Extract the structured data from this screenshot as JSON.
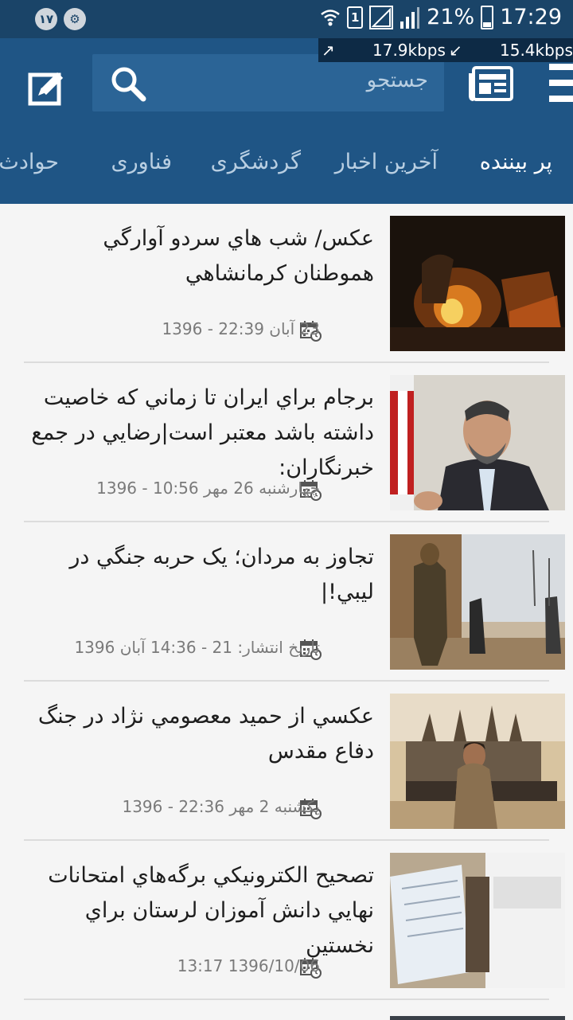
{
  "status_bar": {
    "notification_badge": "١٧",
    "sim_slot": "1",
    "battery_percent": "21%",
    "time": "17:29",
    "upload_speed": "17.9kbps",
    "download_speed": "15.4kbps"
  },
  "search": {
    "placeholder": "جستجو"
  },
  "tabs": [
    {
      "label": "پر بیننده",
      "active": true
    },
    {
      "label": "آخرین اخبار",
      "active": false
    },
    {
      "label": "گردشگری",
      "active": false
    },
    {
      "label": "فناوری",
      "active": false
    },
    {
      "label": "حوادث",
      "active": false
    }
  ],
  "articles": [
    {
      "title": "عكس/ شب هاي سردو آوارگي هموطنان كرمانشاهي",
      "date": "23 آبان 22:39 - 1396"
    },
    {
      "title": "برجام براي ايران تا زماني كه خاصيت داشته باشد معتبر است|رضايي در جمع خبرنگاران:",
      "date": "چهارشنبه 26 مهر 10:56 - 1396"
    },
    {
      "title": "تجاوز به مردان؛ یک حربه جنگي در ليبي!|",
      "date": "تاریخ انتشار: 21 - 14:36 آبان 1396"
    },
    {
      "title": "عكسي از حميد معصومي نژاد در جنگ دفاع مقدس",
      "date": "یکشنبه 2 مهر 22:36 - 1396"
    },
    {
      "title": "تصحيح الكترونيكي برگه‌هاي امتحانات نهايي دانش آموزان لرستان براي نخستين",
      "date": "1396/10/06 13:17"
    }
  ]
}
